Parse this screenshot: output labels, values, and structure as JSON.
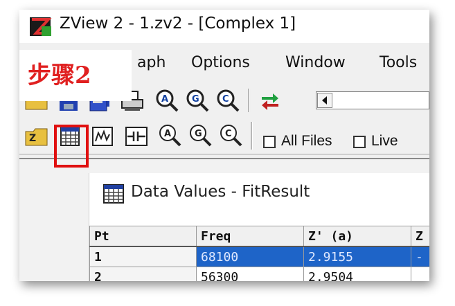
{
  "window": {
    "title": "ZView 2 - 1.zv2 - [Complex 1]",
    "app_icon": "zview-app-icon"
  },
  "menu": {
    "items": [
      "aph",
      "Options",
      "Window",
      "Tools"
    ]
  },
  "annotation": {
    "step_label": "步骤2",
    "highlight_color": "#e01010"
  },
  "toolbar": {
    "row1_icons": [
      "open-folder-icon",
      "save-disk-icon",
      "save-all-icon",
      "print-icon",
      "zoom-a-icon",
      "zoom-g-icon",
      "zoom-c-icon",
      "swap-arrows-icon"
    ],
    "row2_icons": [
      "open-z-file-icon",
      "data-values-icon",
      "fit-icon",
      "circuit-icon",
      "zoom-a-outline-icon",
      "zoom-g-outline-icon",
      "zoom-c-outline-icon"
    ],
    "all_files_label": "All Files",
    "live_label": "Live",
    "all_files_checked": false,
    "live_checked": false
  },
  "data_window": {
    "title": "Data Values - FitResult",
    "columns": [
      "Pt",
      "Freq",
      "Z' (a)",
      "Z"
    ],
    "rows": [
      {
        "pt": "1",
        "freq": "68100",
        "z": "2.9155",
        "z2": "-",
        "selected": true
      },
      {
        "pt": "2",
        "freq": "56300",
        "z": "2.9504",
        "z2": "",
        "selected": false
      }
    ]
  },
  "colors": {
    "selection": "#1e64c8",
    "step_text": "#e02020"
  }
}
